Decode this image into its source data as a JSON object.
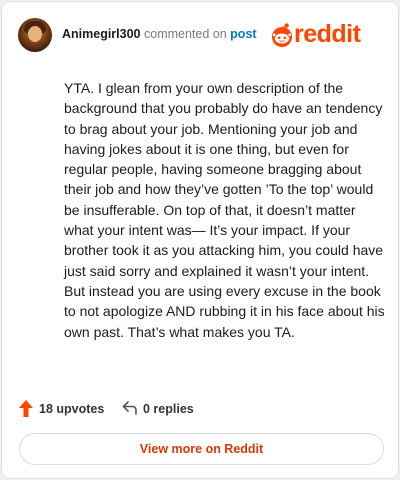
{
  "header": {
    "username": "Animegirl300",
    "action_text": "commented on",
    "post_link": "post",
    "logo_text": "reddit"
  },
  "comment": {
    "text": "YTA. I glean from your own description of the background that you probably do have an tendency to brag about your job. Mentioning your job and having jokes about it is one thing, but even for regular people, having someone bragging about their job and how they’ve gotten ’To the top’ would be insufferable. On top of that, it doesn’t matter what your intent was— It’s your impact. If your brother took it as you attacking him, you could have just said sorry and explained it wasn’t your intent. But instead you are using every excuse in the book to not apologize AND rubbing it in his face about his own past. That’s what makes you TA."
  },
  "footer": {
    "upvotes": "18 upvotes",
    "replies": "0 replies",
    "view_more": "View more on Reddit"
  },
  "colors": {
    "brand": "#ff4500",
    "link": "#0079d3",
    "view_more_text": "#d93a00"
  },
  "icons": {
    "upvote": "upvote-arrow-icon",
    "reply": "reply-arrow-icon",
    "logo": "reddit-snoo-icon"
  }
}
